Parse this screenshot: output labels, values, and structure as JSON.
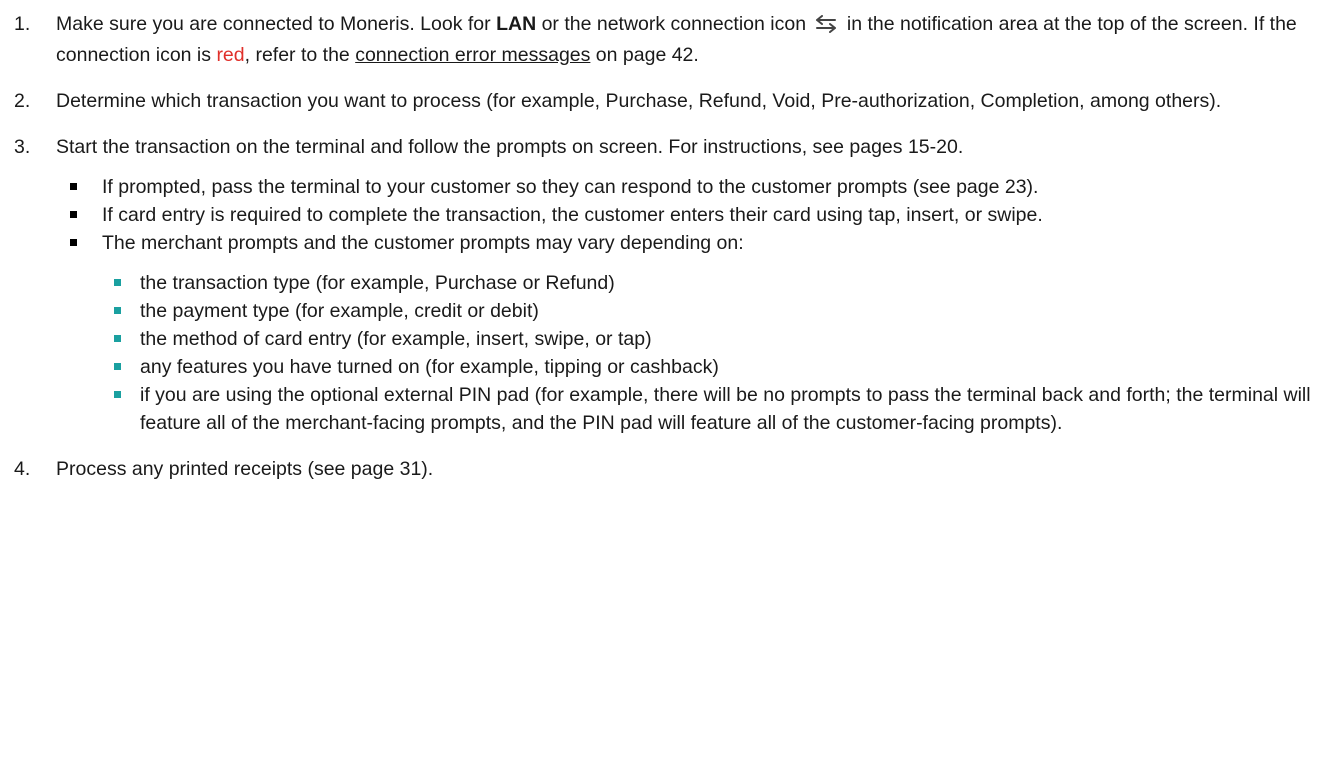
{
  "steps": [
    {
      "number": "1.",
      "part1": "Make sure you are connected to Moneris. Look for ",
      "bold": "LAN",
      "part2": " or the network connection icon",
      "icon": "network-connection-icon",
      "part3": " in the notification area at the top of the screen. If the connection icon is ",
      "red_word": "red",
      "part4": ", refer to the ",
      "link": "connection error messages",
      "part5": " on page 42."
    },
    {
      "number": "2.",
      "text": "Determine which transaction you want to process (for example, Purchase, Refund, Void, Pre-authorization, Completion, among others)."
    },
    {
      "number": "3.",
      "text": "Start the transaction on the terminal and follow the prompts on screen. For instructions, see pages 15-20.",
      "bullets": [
        "If prompted, pass the terminal to your customer so they can respond to the customer prompts (see page 23).",
        "If card entry is required to complete the transaction, the customer enters their card using tap, insert, or swipe.",
        "The merchant prompts and the customer prompts may vary depending on:"
      ],
      "sub_bullets": [
        "the transaction type (for example, Purchase or Refund)",
        "the payment type (for example, credit or debit)",
        "the method of card entry (for example, insert, swipe, or tap)",
        "any features you have turned on (for example, tipping or cashback)",
        "if you are using the optional external PIN pad (for example, there will be no prompts to pass the terminal back and forth; the terminal will feature all of the merchant-facing prompts, and the PIN pad will feature all of the customer-facing prompts)."
      ]
    },
    {
      "number": "4.",
      "text": "Process any printed receipts (see page 31)."
    }
  ],
  "colors": {
    "red": "#e0302a",
    "sub_bullet": "#1aa0a0"
  }
}
